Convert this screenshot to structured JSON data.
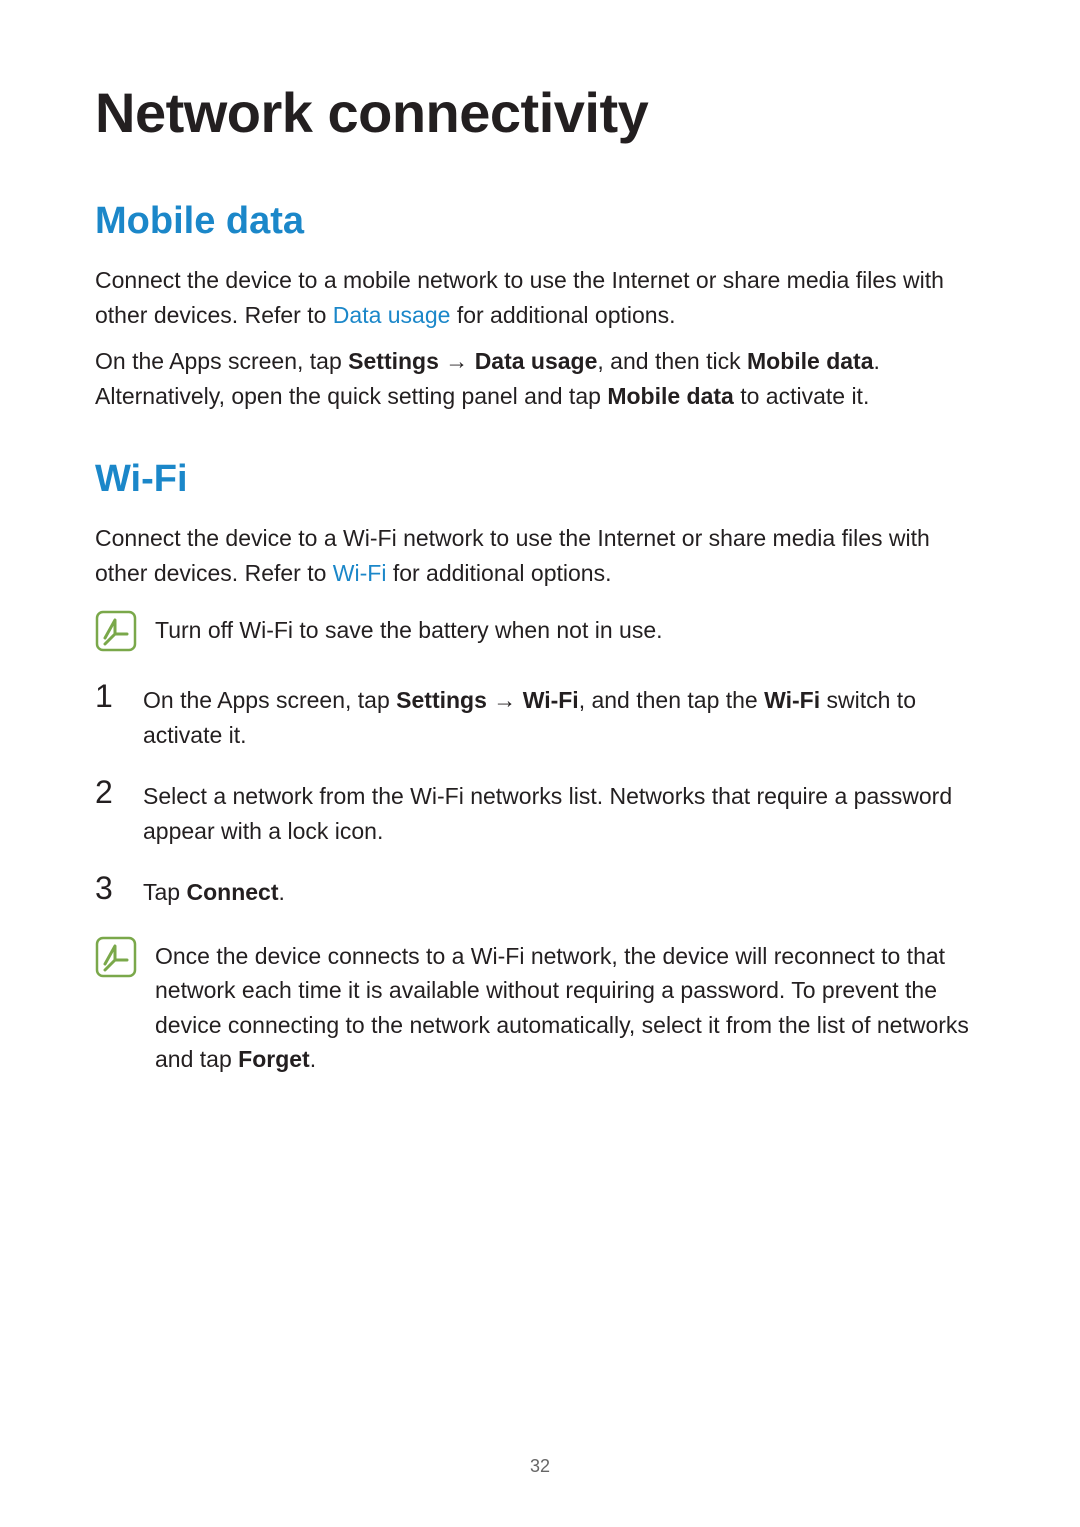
{
  "pageTitle": "Network connectivity",
  "mobile": {
    "heading": "Mobile data",
    "p1_prefix": "Connect the device to a mobile network to use the Internet or share media files with other devices. Refer to ",
    "p1_link": "Data usage",
    "p1_suffix": " for additional options.",
    "p2_a": "On the Apps screen, tap ",
    "p2_settings": "Settings",
    "p2_arrow": " → ",
    "p2_data_usage": "Data usage",
    "p2_b": ", and then tick ",
    "p2_mobile_data": "Mobile data",
    "p2_c": ". Alternatively, open the quick setting panel and tap ",
    "p2_mobile_data2": "Mobile data",
    "p2_d": " to activate it."
  },
  "wifi": {
    "heading": "Wi-Fi",
    "p1_prefix": "Connect the device to a Wi-Fi network to use the Internet or share media files with other devices. Refer to ",
    "p1_link": "Wi-Fi",
    "p1_suffix": " for additional options.",
    "note1": "Turn off Wi-Fi to save the battery when not in use.",
    "steps": [
      {
        "num": "1",
        "a": "On the Apps screen, tap ",
        "settings": "Settings",
        "arrow": " → ",
        "wifi": "Wi-Fi",
        "b": ", and then tap the ",
        "wifi_switch": "Wi-Fi",
        "c": " switch to activate it."
      },
      {
        "num": "2",
        "text": "Select a network from the Wi-Fi networks list. Networks that require a password appear with a lock icon."
      },
      {
        "num": "3",
        "a": "Tap ",
        "connect": "Connect",
        "b": "."
      }
    ],
    "note2_a": "Once the device connects to a Wi-Fi network, the device will reconnect to that network each time it is available without requiring a password. To prevent the device connecting to the network automatically, select it from the list of networks and tap ",
    "note2_forget": "Forget",
    "note2_b": "."
  },
  "pageNumber": "32"
}
